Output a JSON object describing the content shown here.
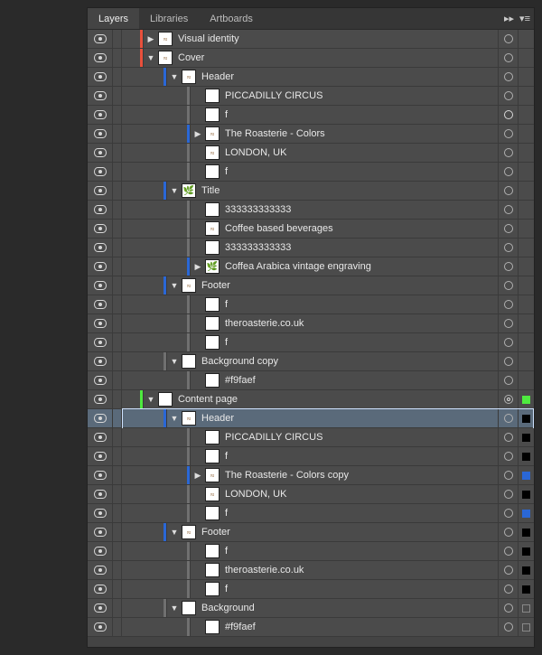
{
  "tabs": [
    {
      "label": "Layers",
      "active": true
    },
    {
      "label": "Libraries",
      "active": false
    },
    {
      "label": "Artboards",
      "active": false
    }
  ],
  "rows": [
    {
      "indent": 0,
      "disclosure": "right",
      "strip": "#e9503c",
      "thumb": "logo",
      "name": "Visual identity",
      "target": "ring",
      "mark": ""
    },
    {
      "indent": 0,
      "disclosure": "down",
      "strip": "#e9503c",
      "thumb": "logo",
      "name": "Cover",
      "target": "ring",
      "mark": ""
    },
    {
      "indent": 1,
      "disclosure": "down",
      "strip": "#2a67d6",
      "thumb": "logo",
      "name": "Header",
      "target": "ring",
      "mark": ""
    },
    {
      "indent": 2,
      "disclosure": "",
      "strip": "#707070",
      "thumb": "white",
      "name": "PICCADILLY CIRCUS",
      "target": "ring",
      "mark": ""
    },
    {
      "indent": 2,
      "disclosure": "",
      "strip": "#707070",
      "thumb": "white",
      "name": "f",
      "target": "filled",
      "mark": ""
    },
    {
      "indent": 2,
      "disclosure": "right",
      "strip": "#2a67d6",
      "thumb": "logo",
      "name": "The Roasterie - Colors",
      "target": "ring",
      "mark": ""
    },
    {
      "indent": 2,
      "disclosure": "",
      "strip": "#707070",
      "thumb": "logo",
      "name": "LONDON, UK",
      "target": "ring",
      "mark": ""
    },
    {
      "indent": 2,
      "disclosure": "",
      "strip": "#707070",
      "thumb": "white",
      "name": "f",
      "target": "ring",
      "mark": ""
    },
    {
      "indent": 1,
      "disclosure": "down",
      "strip": "#2a67d6",
      "thumb": "plant",
      "name": "Title",
      "target": "ring",
      "mark": ""
    },
    {
      "indent": 2,
      "disclosure": "",
      "strip": "#707070",
      "thumb": "white",
      "name": "333333333333",
      "target": "ring",
      "mark": ""
    },
    {
      "indent": 2,
      "disclosure": "",
      "strip": "#707070",
      "thumb": "logo",
      "name": "Coffee based beverages",
      "target": "ring",
      "mark": ""
    },
    {
      "indent": 2,
      "disclosure": "",
      "strip": "#707070",
      "thumb": "white",
      "name": "333333333333",
      "target": "ring",
      "mark": ""
    },
    {
      "indent": 2,
      "disclosure": "right",
      "strip": "#2a67d6",
      "thumb": "plant",
      "name": "Coffea Arabica vintage engraving",
      "target": "ring",
      "mark": ""
    },
    {
      "indent": 1,
      "disclosure": "down",
      "strip": "#2a67d6",
      "thumb": "logo",
      "name": "Footer",
      "target": "ring",
      "mark": ""
    },
    {
      "indent": 2,
      "disclosure": "",
      "strip": "#707070",
      "thumb": "white",
      "name": "f",
      "target": "ring",
      "mark": ""
    },
    {
      "indent": 2,
      "disclosure": "",
      "strip": "#707070",
      "thumb": "white",
      "name": "theroasterie.co.uk",
      "target": "ring",
      "mark": ""
    },
    {
      "indent": 2,
      "disclosure": "",
      "strip": "#707070",
      "thumb": "white",
      "name": "f",
      "target": "ring",
      "mark": ""
    },
    {
      "indent": 1,
      "disclosure": "down",
      "strip": "#707070",
      "thumb": "white",
      "name": "Background copy",
      "target": "ring",
      "mark": ""
    },
    {
      "indent": 2,
      "disclosure": "",
      "strip": "#707070",
      "thumb": "white",
      "name": "#f9faef",
      "target": "ring",
      "mark": ""
    },
    {
      "indent": 0,
      "disclosure": "down",
      "strip": "#4eea3f",
      "thumb": "white",
      "name": "Content page",
      "target": "double",
      "mark": "#4eea3f"
    },
    {
      "indent": 1,
      "disclosure": "down",
      "strip": "#2a67d6",
      "thumb": "logo",
      "name": "Header",
      "target": "ring",
      "mark": "#000",
      "selected": true
    },
    {
      "indent": 2,
      "disclosure": "",
      "strip": "#707070",
      "thumb": "white",
      "name": "PICCADILLY CIRCUS",
      "target": "ring",
      "mark": "#000"
    },
    {
      "indent": 2,
      "disclosure": "",
      "strip": "#707070",
      "thumb": "white",
      "name": "f",
      "target": "ring",
      "mark": "#000"
    },
    {
      "indent": 2,
      "disclosure": "right",
      "strip": "#2a67d6",
      "thumb": "logo",
      "name": "The Roasterie - Colors copy",
      "target": "ring",
      "mark": "#2a67d6"
    },
    {
      "indent": 2,
      "disclosure": "",
      "strip": "#707070",
      "thumb": "logo",
      "name": "LONDON, UK",
      "target": "ring",
      "mark": "#000"
    },
    {
      "indent": 2,
      "disclosure": "",
      "strip": "#707070",
      "thumb": "white",
      "name": "f",
      "target": "ring",
      "mark": "#2a67d6"
    },
    {
      "indent": 1,
      "disclosure": "down",
      "strip": "#2a67d6",
      "thumb": "logo",
      "name": "Footer",
      "target": "ring",
      "mark": "#000"
    },
    {
      "indent": 2,
      "disclosure": "",
      "strip": "#707070",
      "thumb": "white",
      "name": "f",
      "target": "ring",
      "mark": "#000"
    },
    {
      "indent": 2,
      "disclosure": "",
      "strip": "#707070",
      "thumb": "white",
      "name": "theroasterie.co.uk",
      "target": "ring",
      "mark": "#000"
    },
    {
      "indent": 2,
      "disclosure": "",
      "strip": "#707070",
      "thumb": "white",
      "name": "f",
      "target": "ring",
      "mark": "#000"
    },
    {
      "indent": 1,
      "disclosure": "down",
      "strip": "#707070",
      "thumb": "white",
      "name": "Background",
      "target": "ring",
      "mark": "none"
    },
    {
      "indent": 2,
      "disclosure": "",
      "strip": "#707070",
      "thumb": "white",
      "name": "#f9faef",
      "target": "ring",
      "mark": "none"
    }
  ]
}
